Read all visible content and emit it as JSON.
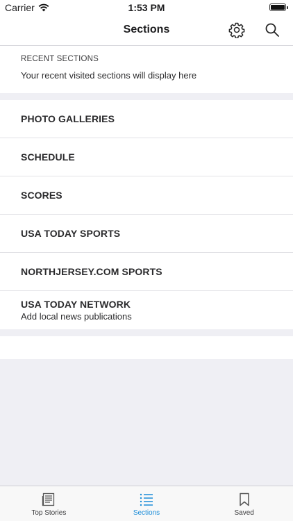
{
  "status": {
    "carrier": "Carrier",
    "time": "1:53 PM"
  },
  "nav": {
    "title": "Sections",
    "settings_icon": "gear-icon",
    "search_icon": "search-icon"
  },
  "recent": {
    "label": "RECENT SECTIONS",
    "note": "Your recent visited sections will display here"
  },
  "sections": [
    {
      "label": "PHOTO GALLERIES"
    },
    {
      "label": "SCHEDULE"
    },
    {
      "label": "SCORES"
    },
    {
      "label": "USA TODAY SPORTS"
    },
    {
      "label": "NORTHJERSEY.COM SPORTS"
    },
    {
      "label": "USA TODAY NETWORK",
      "sub": "Add local news publications"
    }
  ],
  "tabs": [
    {
      "label": "Top Stories",
      "icon": "newspaper-icon",
      "active": false
    },
    {
      "label": "Sections",
      "icon": "list-icon",
      "active": true
    },
    {
      "label": "Saved",
      "icon": "bookmark-icon",
      "active": false
    }
  ],
  "colors": {
    "accent": "#1a8cd8",
    "background": "#efeff4"
  }
}
